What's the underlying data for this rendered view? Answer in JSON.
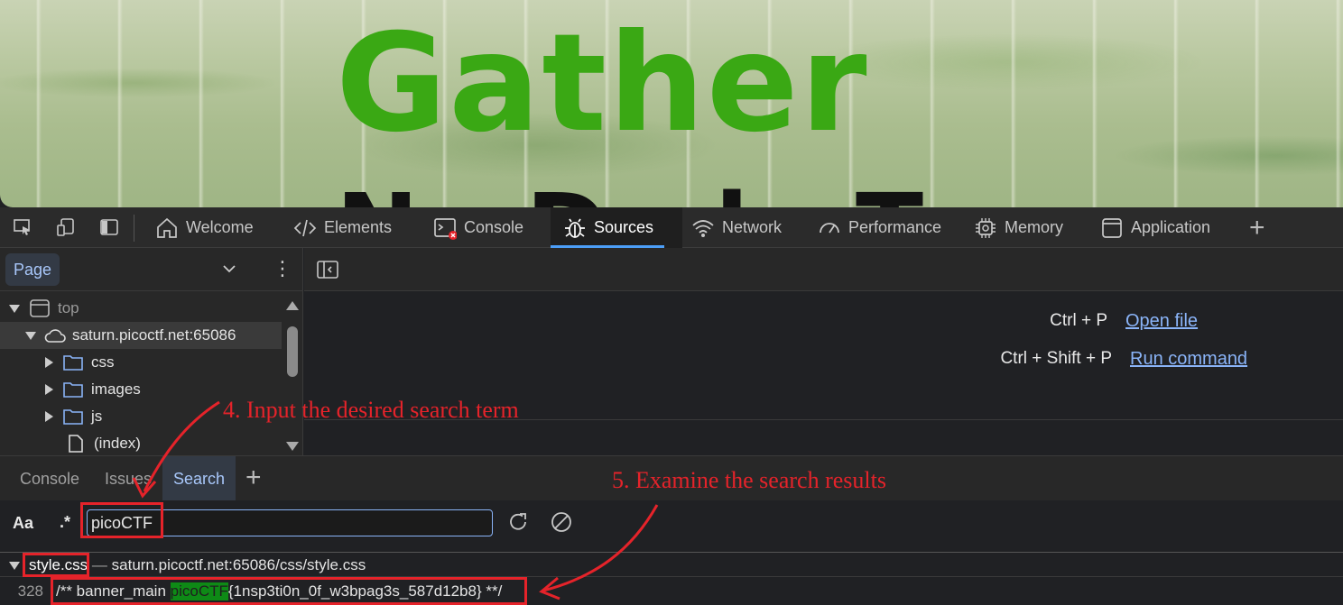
{
  "webpage": {
    "title_line1": "Gather",
    "title_line2": "N   D   l   T"
  },
  "devtools": {
    "tabs": [
      {
        "label": "Welcome",
        "icon": "home-icon"
      },
      {
        "label": "Elements",
        "icon": "code-icon"
      },
      {
        "label": "Console",
        "icon": "console-icon"
      },
      {
        "label": "Sources",
        "icon": "bug-icon",
        "active": true
      },
      {
        "label": "Network",
        "icon": "wifi-icon"
      },
      {
        "label": "Performance",
        "icon": "gauge-icon"
      },
      {
        "label": "Memory",
        "icon": "chip-icon"
      },
      {
        "label": "Application",
        "icon": "window-icon"
      }
    ],
    "accent": "#4c9ef7"
  },
  "navigator": {
    "tab_label": "Page",
    "tree": {
      "top": "top",
      "host": "saturn.picoctf.net:65086",
      "folders": [
        "css",
        "images",
        "js"
      ],
      "file": "(index)"
    }
  },
  "editor": {
    "shortcuts": [
      {
        "keys": "Ctrl + P",
        "action": "Open file"
      },
      {
        "keys": "Ctrl + Shift + P",
        "action": "Run command"
      }
    ]
  },
  "drawer": {
    "tabs": [
      "Console",
      "Issues",
      "Search"
    ],
    "active_tab": "Search",
    "match_case_label": "Aa",
    "regex_label": ".*",
    "search_value": "picoCTF"
  },
  "results": {
    "file_name": "style.css",
    "file_sep": " — ",
    "file_path": "saturn.picoctf.net:65086/css/style.css",
    "line_number": "328",
    "line_prefix": "/** banner_main ",
    "line_match": "picoCTF",
    "line_suffix": "{1nsp3ti0n_0f_w3bpag3s_587d12b8} **/"
  },
  "annotations": {
    "step4": "4. Input the desired search term",
    "step5": "5. Examine the search results",
    "color": "#e5232a"
  }
}
